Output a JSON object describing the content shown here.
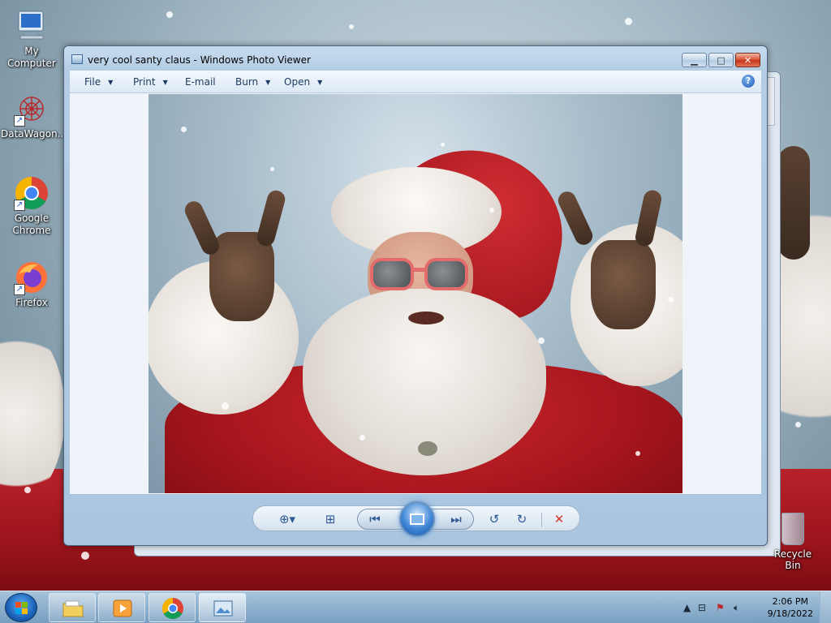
{
  "desktop": {
    "icons": [
      {
        "label": "My Computer"
      },
      {
        "label": "DataWagon..."
      },
      {
        "label": "Google Chrome"
      },
      {
        "label": "Firefox"
      }
    ],
    "recycle_bin": "Recycle Bin"
  },
  "window": {
    "title": "very cool santy claus - Windows Photo Viewer",
    "menu": {
      "file": "File",
      "print": "Print",
      "email": "E-mail",
      "burn": "Burn",
      "open": "Open"
    },
    "help_glyph": "?"
  },
  "taskbar": {
    "time": "2:06 PM",
    "date": "9/18/2022"
  },
  "colors": {
    "close_button": "#c7351a",
    "accent": "#2c5a94"
  }
}
